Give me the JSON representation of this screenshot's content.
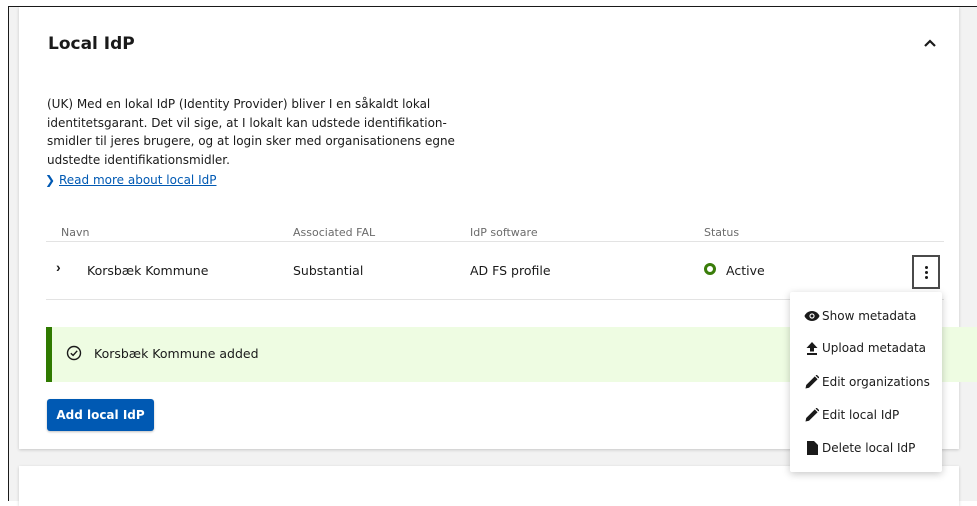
{
  "section": {
    "title": "Local IdP",
    "description": "(UK) Med en lokal IdP (Identity Provider) bliver I en såkaldt lokal identitetsgarant. Det vil sige, at I lokalt kan udstede identifikation-smidler til jeres brugere, og at login sker med organisationens egne udstedte identifikationsmidler.",
    "description_lines": [
      "(UK) Med en lokal IdP (Identity Provider) bliver I en såkaldt lokal",
      "identitetsgarant. Det vil sige, at I lokalt kan udstede identifikation-",
      "smidler til jeres brugere, og at login sker med organisationens egne",
      "udstedte identifikationsmidler."
    ],
    "read_more_link": "Read more about local IdP"
  },
  "table": {
    "headers": [
      "Navn",
      "Associated FAL",
      "IdP software",
      "Status"
    ],
    "rows": [
      {
        "name": "Korsbæk Kommune",
        "fal": "Substantial",
        "software": "AD FS profile",
        "status": "Active"
      }
    ]
  },
  "alert": {
    "message": "Korsbæk Kommune added"
  },
  "add_button": {
    "label": "Add local IdP"
  },
  "menu": {
    "items": [
      {
        "label": "Show metadata",
        "icon": "eye-icon"
      },
      {
        "label": "Upload metadata",
        "icon": "upload-icon"
      },
      {
        "label": "Edit organizations",
        "icon": "pencil-icon"
      },
      {
        "label": "Edit local IdP",
        "icon": "pencil-icon"
      },
      {
        "label": "Delete local IdP",
        "icon": "file-delete-icon"
      }
    ]
  },
  "colors": {
    "primary": "#0059b3",
    "success": "#2f7a00",
    "success_bg": "#eefce2",
    "status_active": "#3a7d0a"
  }
}
